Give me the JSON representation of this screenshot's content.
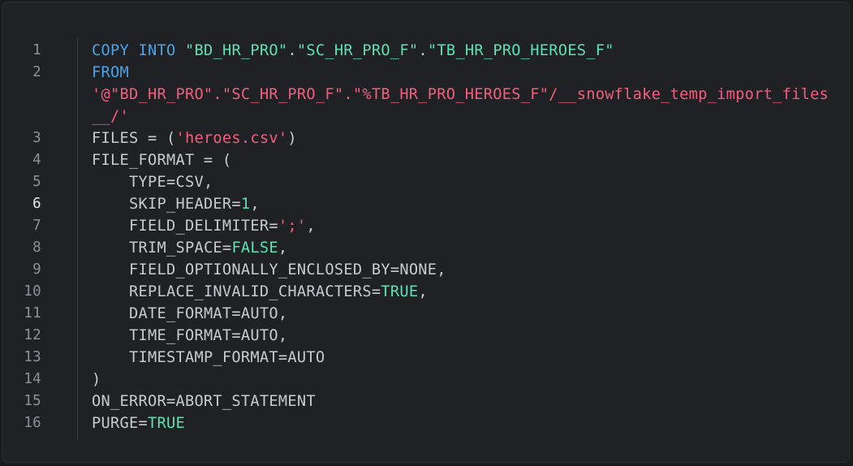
{
  "code_lines": [
    {
      "n": "1",
      "parts": [
        {
          "t": "COPY",
          "c": "kw"
        },
        {
          "t": " ",
          "c": "plain"
        },
        {
          "t": "INTO",
          "c": "kw"
        },
        {
          "t": " ",
          "c": "plain"
        },
        {
          "t": "\"BD_HR_PRO\"",
          "c": "id"
        },
        {
          "t": ".",
          "c": "plain"
        },
        {
          "t": "\"SC_HR_PRO_F\"",
          "c": "id"
        },
        {
          "t": ".",
          "c": "plain"
        },
        {
          "t": "\"TB_HR_PRO_HEROES_F\"",
          "c": "id"
        }
      ]
    },
    {
      "n": "2",
      "parts": [
        {
          "t": "FROM",
          "c": "kw"
        }
      ]
    },
    {
      "n": "",
      "parts": [
        {
          "t": "'@\"BD_HR_PRO\".\"SC_HR_PRO_F\".\"%TB_HR_PRO_HEROES_F\"/__snowflake_temp_import_files__/'",
          "c": "str"
        }
      ]
    },
    {
      "n": "3",
      "parts": [
        {
          "t": "FILES = (",
          "c": "plain"
        },
        {
          "t": "'heroes.csv'",
          "c": "str"
        },
        {
          "t": ")",
          "c": "plain"
        }
      ]
    },
    {
      "n": "4",
      "parts": [
        {
          "t": "FILE_FORMAT = (",
          "c": "plain"
        }
      ]
    },
    {
      "n": "5",
      "parts": [
        {
          "t": "    TYPE=CSV,",
          "c": "plain"
        }
      ]
    },
    {
      "n": "6",
      "active": true,
      "parts": [
        {
          "t": "    SKIP_HEADER=",
          "c": "plain"
        },
        {
          "t": "1",
          "c": "num"
        },
        {
          "t": ",",
          "c": "plain"
        }
      ]
    },
    {
      "n": "7",
      "parts": [
        {
          "t": "    FIELD_DELIMITER=",
          "c": "plain"
        },
        {
          "t": "';'",
          "c": "str"
        },
        {
          "t": ",",
          "c": "plain"
        }
      ]
    },
    {
      "n": "8",
      "parts": [
        {
          "t": "    TRIM_SPACE=",
          "c": "plain"
        },
        {
          "t": "FALSE",
          "c": "bool"
        },
        {
          "t": ",",
          "c": "plain"
        }
      ]
    },
    {
      "n": "9",
      "parts": [
        {
          "t": "    FIELD_OPTIONALLY_ENCLOSED_BY=NONE,",
          "c": "plain"
        }
      ]
    },
    {
      "n": "10",
      "parts": [
        {
          "t": "    REPLACE_INVALID_CHARACTERS=",
          "c": "plain"
        },
        {
          "t": "TRUE",
          "c": "bool"
        },
        {
          "t": ",",
          "c": "plain"
        }
      ]
    },
    {
      "n": "11",
      "parts": [
        {
          "t": "    DATE_FORMAT=AUTO,",
          "c": "plain"
        }
      ]
    },
    {
      "n": "12",
      "parts": [
        {
          "t": "    TIME_FORMAT=AUTO,",
          "c": "plain"
        }
      ]
    },
    {
      "n": "13",
      "parts": [
        {
          "t": "    TIMESTAMP_FORMAT=AUTO",
          "c": "plain"
        }
      ]
    },
    {
      "n": "14",
      "parts": [
        {
          "t": ")",
          "c": "plain"
        }
      ]
    },
    {
      "n": "15",
      "parts": [
        {
          "t": "ON_ERROR=ABORT_STATEMENT",
          "c": "plain"
        }
      ]
    },
    {
      "n": "16",
      "parts": [
        {
          "t": "PURGE=",
          "c": "plain"
        },
        {
          "t": "TRUE",
          "c": "bool"
        }
      ]
    }
  ]
}
